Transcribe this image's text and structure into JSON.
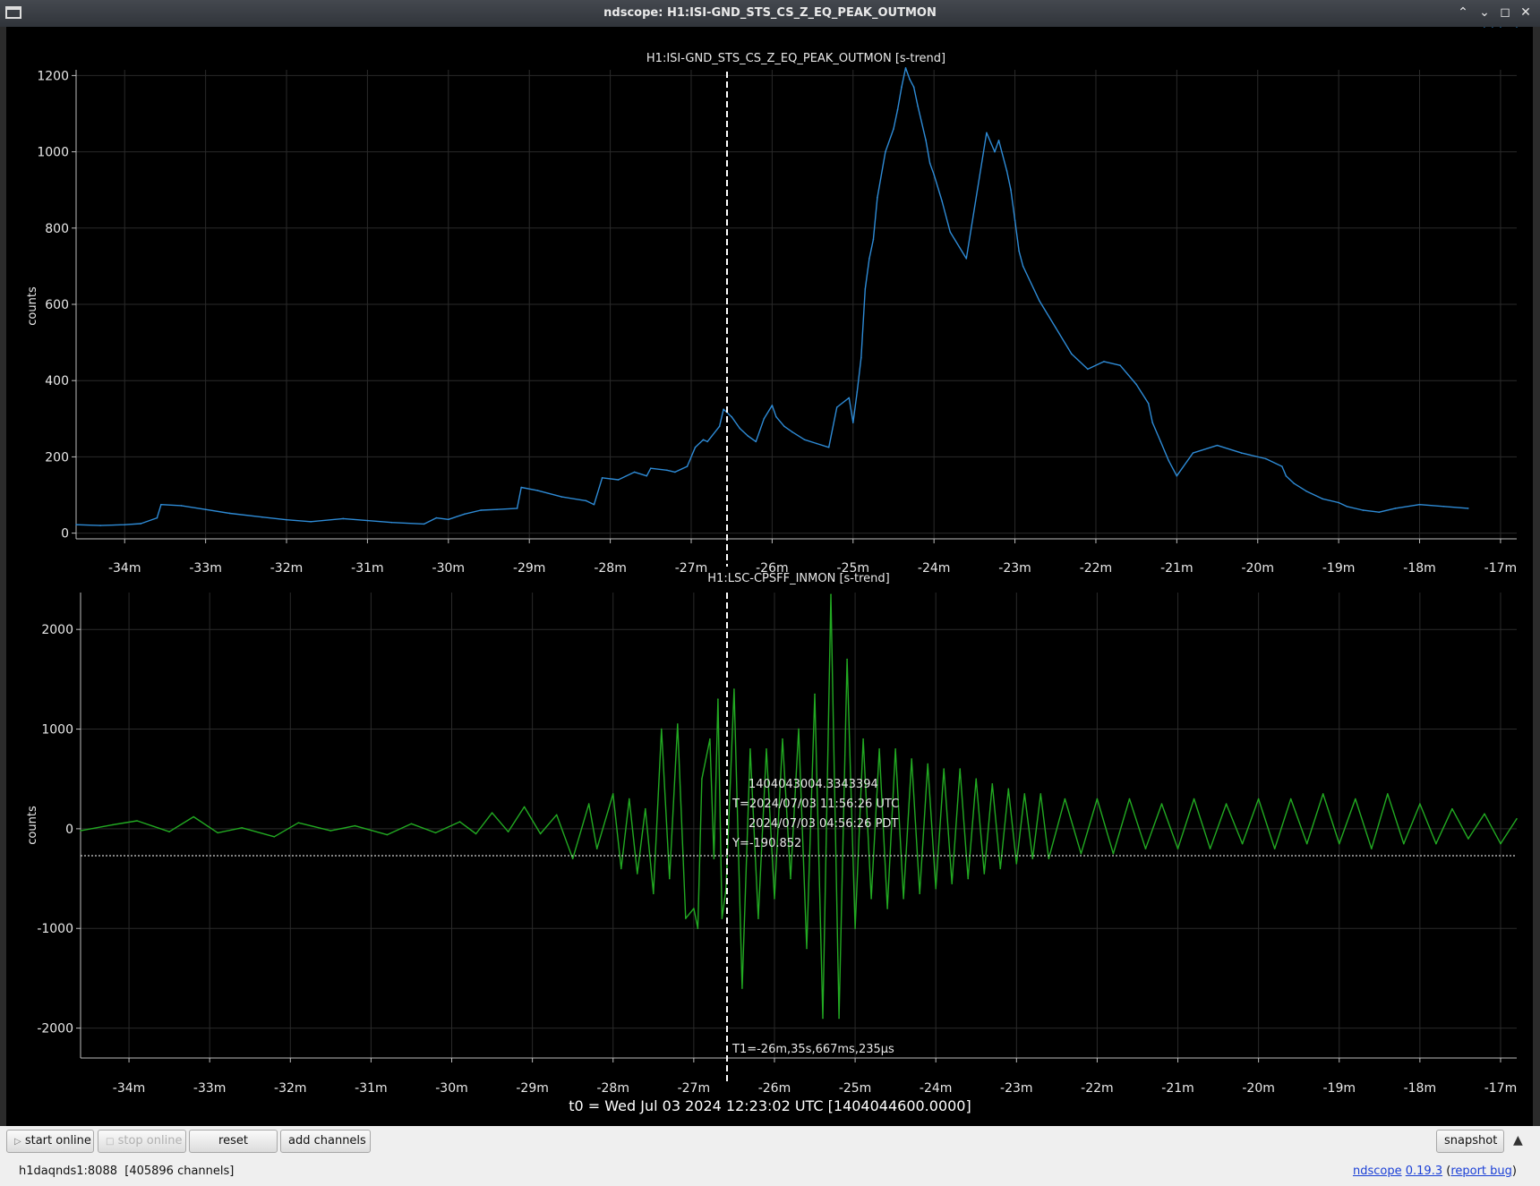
{
  "window": {
    "title": "ndscope: H1:ISI-GND_STS_CS_Z_EQ_PEAK_OUTMON"
  },
  "plots": [
    {
      "title": "H1:ISI-GND_STS_CS_Z_EQ_PEAK_OUTMON [s-trend]",
      "ylabel": "counts",
      "yticks": [
        "0",
        "200",
        "400",
        "600",
        "800",
        "1000",
        "1200"
      ],
      "xticks": [
        "-34m",
        "-33m",
        "-32m",
        "-31m",
        "-30m",
        "-29m",
        "-28m",
        "-27m",
        "-26m",
        "-25m",
        "-24m",
        "-23m",
        "-22m",
        "-21m",
        "-20m",
        "-19m",
        "-18m",
        "-17m"
      ]
    },
    {
      "title": "H1:LSC-CPSFF_INMON [s-trend]",
      "ylabel": "counts",
      "yticks": [
        "-2000",
        "-1000",
        "0",
        "1000",
        "2000"
      ],
      "xticks": [
        "-34m",
        "-33m",
        "-32m",
        "-31m",
        "-30m",
        "-29m",
        "-28m",
        "-27m",
        "-26m",
        "-25m",
        "-24m",
        "-23m",
        "-22m",
        "-21m",
        "-20m",
        "-19m",
        "-18m",
        "-17m"
      ]
    }
  ],
  "cursor": {
    "gps": "1404043004.3343394",
    "utc": "T=2024/07/03 11:56:26 UTC",
    "pdt": "2024/07/03 04:56:26 PDT",
    "y": "Y=-190.852",
    "t1": "T1=-26m,35s,667ms,235µs"
  },
  "t0_label": "t0 = Wed Jul 03 2024 12:23:02 UTC [1404044600.0000]",
  "toolbar": {
    "start_online": "start online",
    "stop_online": "stop online",
    "reset": "reset",
    "add_channels": "add channels",
    "snapshot": "snapshot"
  },
  "status": {
    "server": "h1daqnds1:8088  [405896 channels]",
    "app": "ndscope",
    "version": "0.19.3",
    "report_bug": "report bug"
  },
  "colors": {
    "series1": "#2e8bd6",
    "series2": "#22aa22",
    "cursor": "#ffffff",
    "background": "#000000"
  },
  "chart_data": [
    {
      "type": "line",
      "title": "H1:ISI-GND_STS_CS_Z_EQ_PEAK_OUTMON [s-trend]",
      "ylabel": "counts",
      "xlabel": "",
      "x_unit": "minutes relative to t0",
      "xlim": [
        -34.6,
        -16.8
      ],
      "ylim": [
        -15,
        1215
      ],
      "grid": true,
      "x": [
        -34.6,
        -34.3,
        -34.0,
        -33.8,
        -33.6,
        -33.55,
        -33.3,
        -33.0,
        -32.7,
        -32.3,
        -32.0,
        -31.7,
        -31.3,
        -31.0,
        -30.7,
        -30.3,
        -30.15,
        -30.0,
        -29.8,
        -29.6,
        -29.4,
        -29.15,
        -29.1,
        -28.9,
        -28.6,
        -28.3,
        -28.2,
        -28.1,
        -27.9,
        -27.7,
        -27.55,
        -27.5,
        -27.3,
        -27.2,
        -27.05,
        -26.95,
        -26.85,
        -26.8,
        -26.65,
        -26.6,
        -26.5,
        -26.4,
        -26.3,
        -26.2,
        -26.1,
        -26.0,
        -25.95,
        -25.85,
        -25.75,
        -25.6,
        -25.45,
        -25.3,
        -25.2,
        -25.05,
        -25.0,
        -24.95,
        -24.9,
        -24.85,
        -24.8,
        -24.75,
        -24.7,
        -24.6,
        -24.5,
        -24.45,
        -24.4,
        -24.35,
        -24.3,
        -24.25,
        -24.2,
        -24.1,
        -24.05,
        -24.0,
        -23.9,
        -23.8,
        -23.6,
        -23.35,
        -23.25,
        -23.2,
        -23.1,
        -23.05,
        -23.0,
        -22.95,
        -22.9,
        -22.7,
        -22.5,
        -22.3,
        -22.1,
        -21.9,
        -21.7,
        -21.5,
        -21.35,
        -21.3,
        -21.2,
        -21.1,
        -21.0,
        -20.8,
        -20.5,
        -20.2,
        -19.9,
        -19.7,
        -19.65,
        -19.55,
        -19.4,
        -19.2,
        -19.0,
        -18.9,
        -18.7,
        -18.5,
        -18.3,
        -18.0,
        -17.7,
        -17.4,
        -17.2,
        -17.1,
        -17.0,
        -16.8
      ],
      "values": [
        22,
        20,
        22,
        25,
        40,
        75,
        72,
        62,
        52,
        42,
        35,
        30,
        38,
        33,
        28,
        24,
        40,
        36,
        50,
        60,
        62,
        65,
        120,
        112,
        95,
        85,
        75,
        145,
        140,
        160,
        150,
        170,
        165,
        160,
        175,
        225,
        245,
        240,
        280,
        325,
        305,
        275,
        255,
        240,
        300,
        335,
        305,
        280,
        265,
        245,
        235,
        225,
        330,
        355,
        290,
        370,
        460,
        640,
        720,
        770,
        880,
        1000,
        1060,
        1110,
        1170,
        1220,
        1190,
        1170,
        1120,
        1030,
        970,
        940,
        870,
        790,
        720,
        1050,
        1000,
        1030,
        950,
        900,
        820,
        740,
        700,
        610,
        540,
        470,
        430,
        450,
        440,
        390,
        340,
        290,
        240,
        190,
        150,
        210,
        230,
        210,
        195,
        175,
        150,
        130,
        110,
        90,
        80,
        70,
        60,
        55,
        65,
        75,
        70,
        65
      ]
    },
    {
      "type": "line",
      "title": "H1:LSC-CPSFF_INMON [s-trend]",
      "ylabel": "counts",
      "xlabel": "",
      "x_unit": "minutes relative to t0",
      "xlim": [
        -34.6,
        -16.8
      ],
      "ylim": [
        -2300,
        2370
      ],
      "grid": true,
      "x": [
        -34.6,
        -34.2,
        -33.9,
        -33.5,
        -33.2,
        -32.9,
        -32.6,
        -32.2,
        -31.9,
        -31.5,
        -31.2,
        -30.8,
        -30.5,
        -30.2,
        -29.9,
        -29.7,
        -29.5,
        -29.3,
        -29.1,
        -28.9,
        -28.7,
        -28.5,
        -28.3,
        -28.2,
        -28.0,
        -27.9,
        -27.8,
        -27.7,
        -27.6,
        -27.5,
        -27.4,
        -27.3,
        -27.2,
        -27.1,
        -27.0,
        -26.95,
        -26.9,
        -26.8,
        -26.75,
        -26.7,
        -26.65,
        -26.6,
        -26.5,
        -26.4,
        -26.3,
        -26.2,
        -26.1,
        -26.0,
        -25.9,
        -25.8,
        -25.7,
        -25.6,
        -25.5,
        -25.4,
        -25.3,
        -25.2,
        -25.1,
        -25.0,
        -24.9,
        -24.8,
        -24.7,
        -24.6,
        -24.5,
        -24.4,
        -24.3,
        -24.2,
        -24.1,
        -24.0,
        -23.9,
        -23.8,
        -23.7,
        -23.6,
        -23.5,
        -23.4,
        -23.3,
        -23.2,
        -23.1,
        -23.0,
        -22.9,
        -22.8,
        -22.7,
        -22.6,
        -22.4,
        -22.2,
        -22.0,
        -21.8,
        -21.6,
        -21.4,
        -21.2,
        -21.0,
        -20.8,
        -20.6,
        -20.4,
        -20.2,
        -20.0,
        -19.8,
        -19.6,
        -19.4,
        -19.2,
        -19.0,
        -18.8,
        -18.6,
        -18.4,
        -18.2,
        -18.0,
        -17.8,
        -17.6,
        -17.4,
        -17.2,
        -17.0,
        -16.8
      ],
      "values": [
        -20,
        40,
        80,
        -30,
        120,
        -40,
        10,
        -80,
        60,
        -20,
        30,
        -60,
        50,
        -40,
        70,
        -50,
        160,
        -30,
        220,
        -50,
        140,
        -300,
        250,
        -200,
        350,
        -400,
        300,
        -450,
        200,
        -650,
        1000,
        -500,
        1050,
        -900,
        -800,
        -1000,
        500,
        900,
        -300,
        1300,
        -900,
        -600,
        1400,
        -1600,
        800,
        -900,
        800,
        -700,
        900,
        -500,
        1000,
        -1200,
        1350,
        -1900,
        2350,
        -1900,
        1700,
        -1000,
        900,
        -700,
        800,
        -800,
        800,
        -700,
        700,
        -650,
        650,
        -600,
        600,
        -550,
        600,
        -500,
        500,
        -450,
        450,
        -400,
        400,
        -350,
        350,
        -300,
        350,
        -300,
        300,
        -250,
        300,
        -250,
        300,
        -200,
        250,
        -200,
        300,
        -200,
        250,
        -150,
        300,
        -200,
        300,
        -150,
        350,
        -150,
        300,
        -200,
        350,
        -150,
        250,
        -150,
        200,
        -100,
        150,
        -150,
        100,
        -100,
        20
      ]
    }
  ]
}
